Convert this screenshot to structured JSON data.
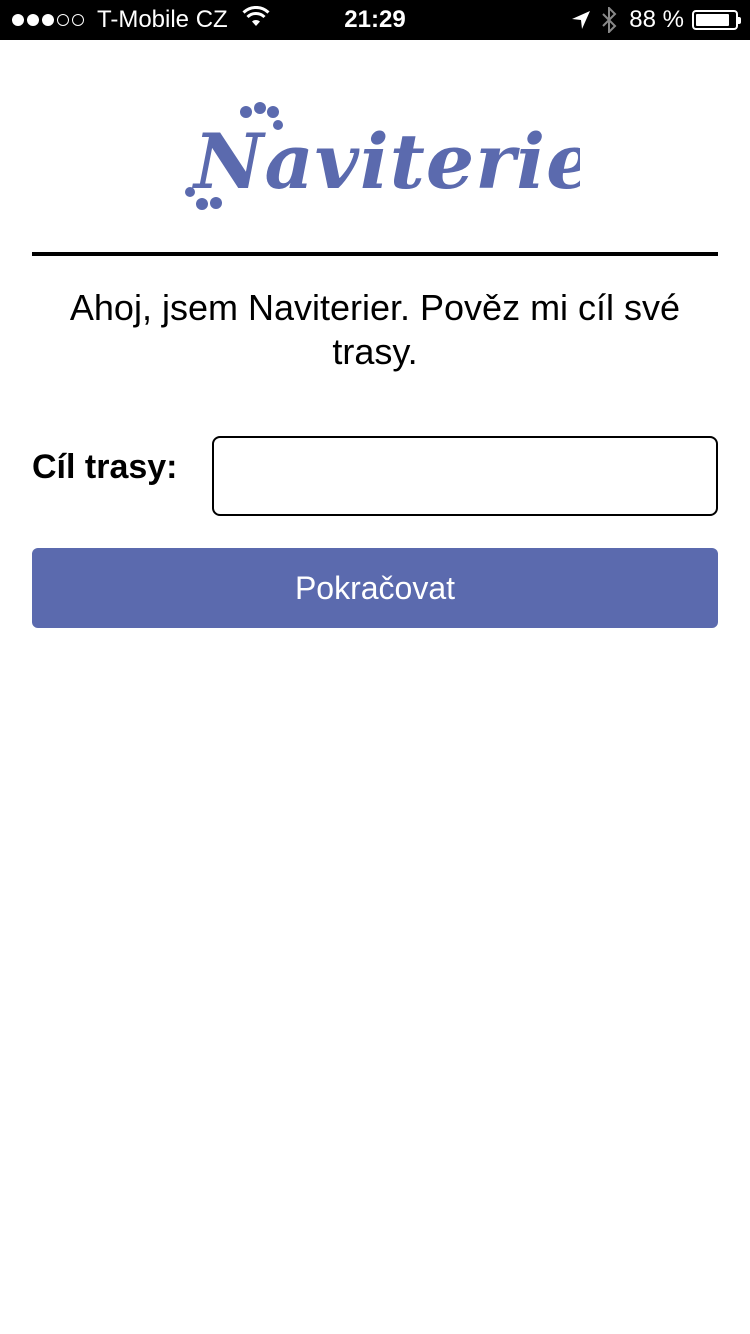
{
  "status_bar": {
    "carrier": "T-Mobile CZ",
    "time": "21:29",
    "battery_percent": "88 %",
    "battery_level": 0.88,
    "signal_bars_filled": 3,
    "signal_bars_total": 5,
    "icons": [
      "signal-dots-icon",
      "wifi-icon",
      "location-arrow-icon",
      "bluetooth-icon",
      "battery-icon"
    ]
  },
  "app": {
    "logo_text": "Naviterier",
    "brand_color": "#5b6aae"
  },
  "greeting": "Ahoj, jsem Naviterier. Pověz mi cíl své trasy.",
  "form": {
    "destination_label": "Cíl trasy:",
    "destination_value": "",
    "continue_label": "Pokračovat"
  }
}
